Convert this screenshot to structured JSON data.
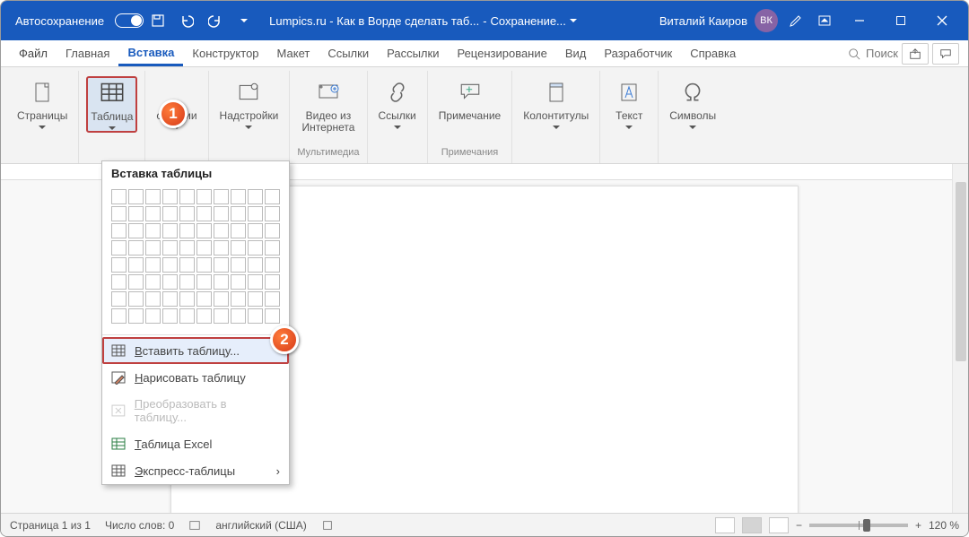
{
  "titlebar": {
    "autosave": "Автосохранение",
    "doc_title": "Lumpics.ru - Как в Ворде сделать таб...",
    "saving": "Сохранение... ",
    "user": "Виталий Каиров",
    "initials": "ВК"
  },
  "tabs": {
    "file": "Файл",
    "home": "Главная",
    "insert": "Вставка",
    "design": "Конструктор",
    "layout": "Макет",
    "references": "Ссылки",
    "mailings": "Рассылки",
    "review": "Рецензирование",
    "view": "Вид",
    "developer": "Разработчик",
    "help": "Справка",
    "search": "Поиск"
  },
  "ribbon": {
    "pages": {
      "label": "Страницы"
    },
    "table": {
      "label": "Таблица"
    },
    "illustrations": {
      "label": "страции"
    },
    "addins": {
      "label": "Надстройки"
    },
    "video": {
      "label1": "Видео из",
      "label2": "Интернета",
      "group": "Мультимедиа"
    },
    "links": {
      "label": "Ссылки"
    },
    "comment": {
      "label": "Примечание",
      "group": "Примечания"
    },
    "headers": {
      "label": "Колонтитулы"
    },
    "text": {
      "label": "Текст"
    },
    "symbols": {
      "label": "Символы"
    }
  },
  "dropdown": {
    "header": "Вставка таблицы",
    "insert_table": "Вставить таблицу...",
    "draw_table": "Нарисовать таблицу",
    "convert": "Преобразовать в таблицу...",
    "excel": "Таблица Excel",
    "quick": "Экспресс-таблицы"
  },
  "callouts": {
    "one": "1",
    "two": "2"
  },
  "status": {
    "page": "Страница 1 из 1",
    "words": "Число слов: 0",
    "lang": "английский (США)",
    "zoom": "120 %"
  }
}
